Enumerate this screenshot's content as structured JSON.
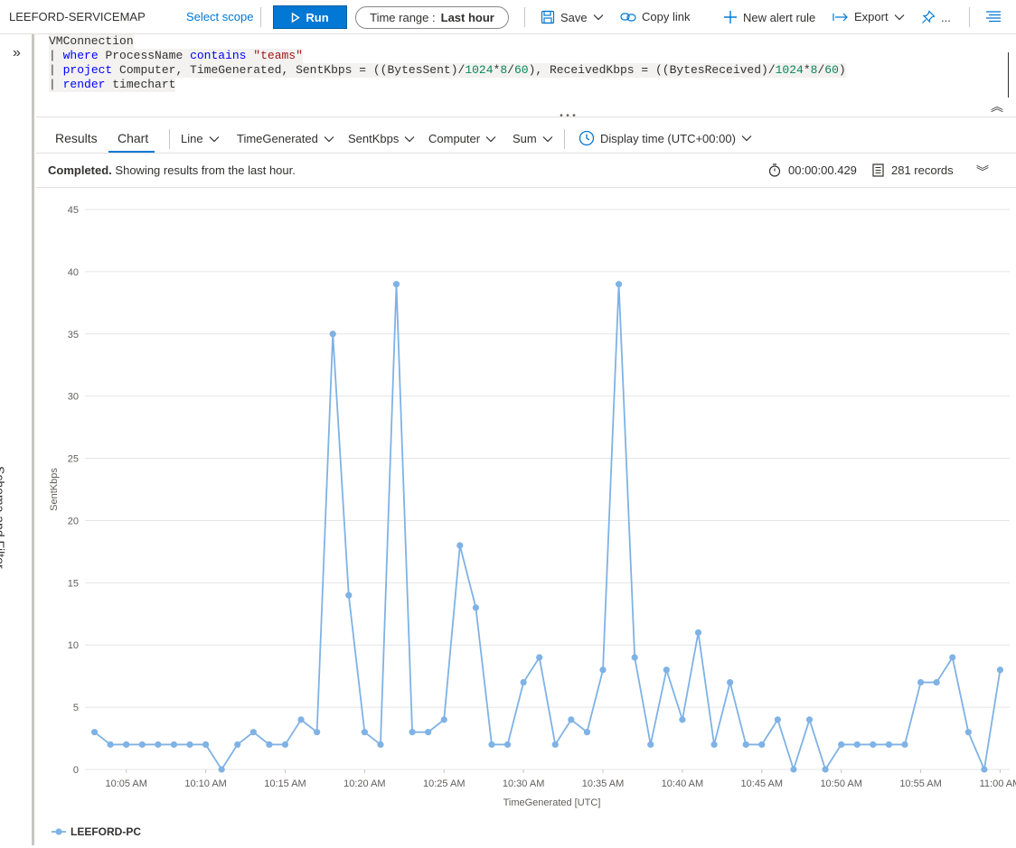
{
  "toolbar": {
    "workspace": "LEEFORD-SERVICEMAP",
    "select_scope": "Select scope",
    "run": "Run",
    "time_range_label": "Time range :",
    "time_range_value": "Last hour",
    "save": "Save",
    "copy_link": "Copy link",
    "new_alert_rule": "New alert rule",
    "export": "Export",
    "more": "..."
  },
  "left_panel": {
    "label": "Schema and Filter"
  },
  "query": {
    "line1": "VMConnection",
    "line2_kw1": "where",
    "line2_a": " ProcessName ",
    "line2_kw2": "contains",
    "line2_str": "\"teams\"",
    "line3_kw": "project",
    "line3_a": " Computer, TimeGenerated, SentKbps = ((BytesSent)/",
    "line3_n1": "1024",
    "line3_b": "*",
    "line3_n2": "8",
    "line3_c": "/",
    "line3_n3": "60",
    "line3_d": "), ReceivedKbps = ((BytesReceived)/",
    "line3_n4": "1024",
    "line3_e": "*",
    "line3_n5": "8",
    "line3_f": "/",
    "line3_n6": "60",
    "line3_g": ")",
    "line4_kw": "render",
    "line4_a": " timechart",
    "pipe": "|"
  },
  "tabs": {
    "results": "Results",
    "chart": "Chart"
  },
  "chart_options": {
    "type": "Line",
    "x_column": "TimeGenerated",
    "y_column": "SentKbps",
    "split_by": "Computer",
    "aggregation": "Sum",
    "display_time": "Display time (UTC+00:00)"
  },
  "status": {
    "completed": "Completed.",
    "message": "Showing results from the last hour.",
    "duration": "00:00:00.429",
    "records": "281 records"
  },
  "chart_data": {
    "type": "line",
    "xlabel": "TimeGenerated [UTC]",
    "ylabel": "SentKbps",
    "ylim": [
      0,
      45
    ],
    "y_ticks": [
      0,
      5,
      10,
      15,
      20,
      25,
      30,
      35,
      40,
      45
    ],
    "x_ticks": [
      "10:05 AM",
      "10:10 AM",
      "10:15 AM",
      "10:20 AM",
      "10:25 AM",
      "10:30 AM",
      "10:35 AM",
      "10:40 AM",
      "10:45 AM",
      "10:50 AM",
      "10:55 AM",
      "11:00 AM"
    ],
    "x_range_minutes": [
      2.4,
      60.6
    ],
    "grid": true,
    "legend_position": "bottom-left",
    "color": "#7fb2e5",
    "series": [
      {
        "name": "LEEFORD-PC",
        "x_minutes": [
          3,
          4,
          5,
          6,
          7,
          8,
          9,
          10,
          11,
          12,
          13,
          14,
          15,
          16,
          17,
          18,
          19,
          20,
          21,
          22,
          23,
          24,
          25,
          26,
          27,
          28,
          29,
          30,
          31,
          32,
          33,
          34,
          35,
          36,
          37,
          38,
          39,
          40,
          41,
          42,
          43,
          44,
          45,
          46,
          47,
          48,
          49,
          50,
          51,
          52,
          53,
          54,
          55,
          56,
          57,
          58,
          59,
          60
        ],
        "values": [
          3,
          2,
          2,
          2,
          2,
          2,
          2,
          2,
          0,
          2,
          3,
          2,
          2,
          4,
          3,
          35,
          14,
          3,
          2,
          39,
          3,
          3,
          4,
          18,
          13,
          2,
          2,
          7,
          9,
          2,
          4,
          3,
          8,
          39,
          9,
          2,
          8,
          4,
          11,
          2,
          7,
          2,
          2,
          4,
          0,
          4,
          0,
          2,
          2,
          2,
          2,
          2,
          7,
          7,
          9,
          3,
          0,
          8
        ]
      }
    ]
  }
}
